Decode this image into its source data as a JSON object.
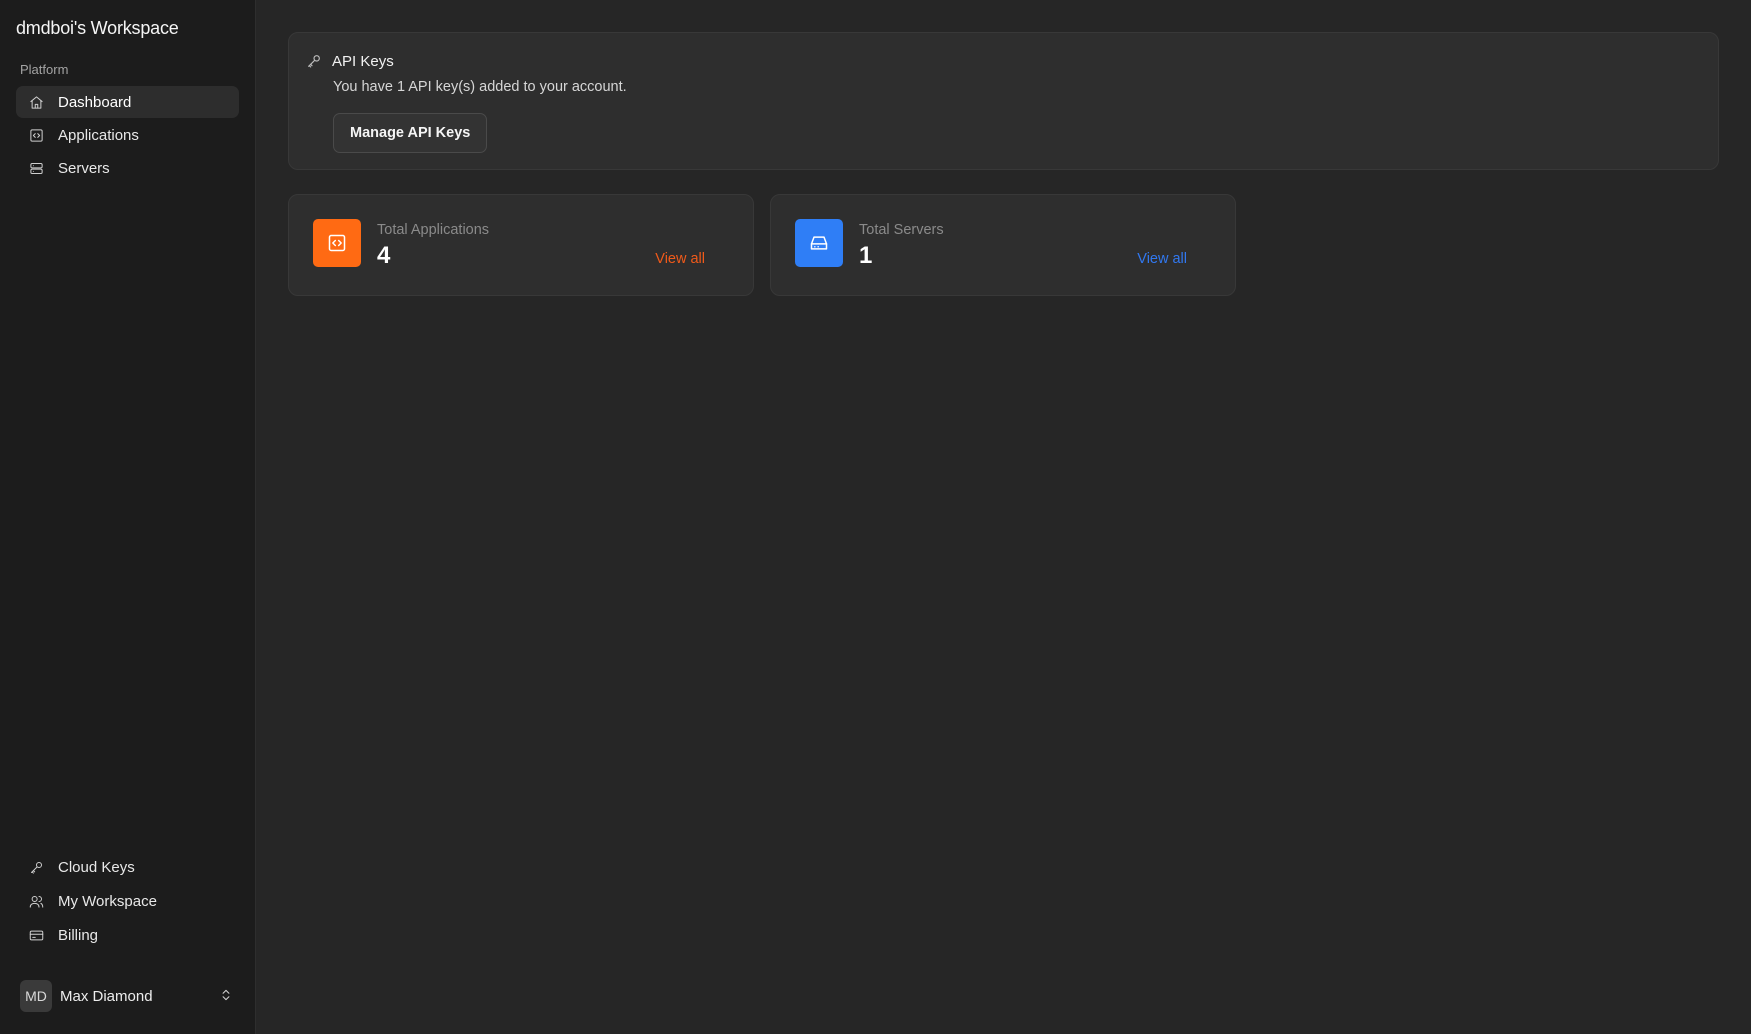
{
  "workspace": {
    "title": "dmdboi's Workspace"
  },
  "sidebar": {
    "section_label": "Platform",
    "items": [
      {
        "label": "Dashboard",
        "icon": "home-icon",
        "active": true
      },
      {
        "label": "Applications",
        "icon": "code-square-icon",
        "active": false
      },
      {
        "label": "Servers",
        "icon": "server-icon",
        "active": false
      }
    ],
    "bottom_items": [
      {
        "label": "Cloud Keys",
        "icon": "key-icon"
      },
      {
        "label": "My Workspace",
        "icon": "users-icon"
      },
      {
        "label": "Billing",
        "icon": "credit-card-icon"
      }
    ],
    "user": {
      "initials": "MD",
      "name": "Max Diamond",
      "icon": "chevrons-up-down-icon"
    }
  },
  "api_keys": {
    "title": "API Keys",
    "icon": "key-icon",
    "description": "You have 1 API key(s) added to your account.",
    "button_label": "Manage API Keys"
  },
  "stats": [
    {
      "label": "Total Applications",
      "value": "4",
      "link": "View all",
      "icon": "code-square-icon",
      "color": "#ff6a13",
      "link_color": "#f05a1a"
    },
    {
      "label": "Total Servers",
      "value": "1",
      "link": "View all",
      "icon": "hard-drive-icon",
      "color": "#2f7ef6",
      "link_color": "#3178f0"
    }
  ],
  "colors": {
    "background": "#262626",
    "sidebar": "#1c1c1c",
    "card": "#2e2e2e"
  }
}
